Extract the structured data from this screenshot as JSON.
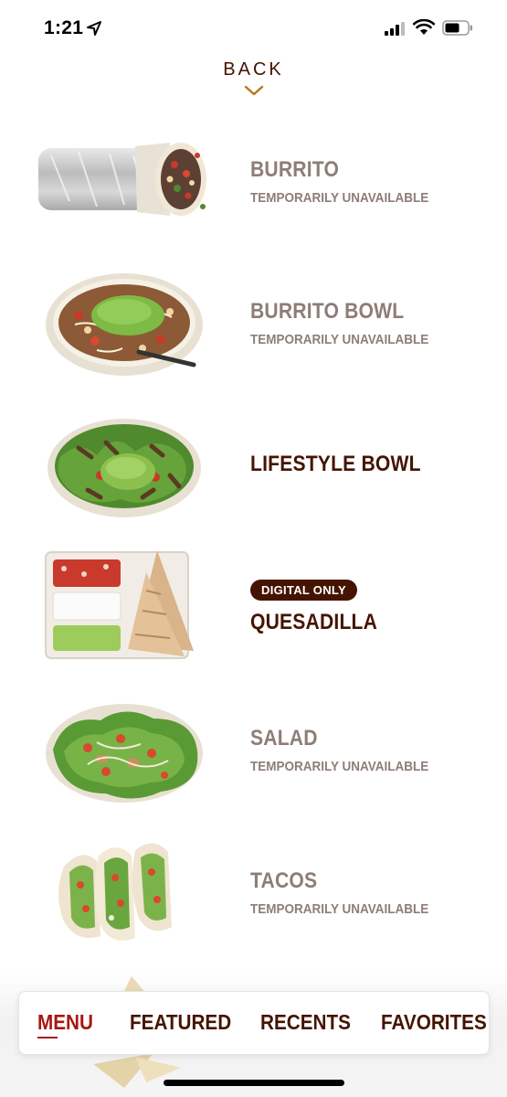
{
  "status_bar": {
    "time": "1:21",
    "icons": [
      "location-arrow-icon",
      "cellular-signal-icon",
      "wifi-icon",
      "battery-icon"
    ]
  },
  "back": {
    "label": "BACK",
    "icon": "chevron-down-icon"
  },
  "menu": {
    "items": [
      {
        "name": "BURRITO",
        "status": "TEMPORARILY UNAVAILABLE",
        "badge": "",
        "image": "burrito-image"
      },
      {
        "name": "BURRITO BOWL",
        "status": "TEMPORARILY UNAVAILABLE",
        "badge": "",
        "image": "burrito-bowl-image"
      },
      {
        "name": "LIFESTYLE BOWL",
        "status": "",
        "badge": "",
        "image": "lifestyle-bowl-image"
      },
      {
        "name": "QUESADILLA",
        "status": "",
        "badge": "DIGITAL ONLY",
        "image": "quesadilla-image"
      },
      {
        "name": "SALAD",
        "status": "TEMPORARILY UNAVAILABLE",
        "badge": "",
        "image": "salad-image"
      },
      {
        "name": "TACOS",
        "status": "TEMPORARILY UNAVAILABLE",
        "badge": "",
        "image": "tacos-image"
      }
    ]
  },
  "bottom_nav": {
    "tabs": [
      {
        "label": "MENU",
        "active": true
      },
      {
        "label": "FEATURED",
        "active": false
      },
      {
        "label": "RECENTS",
        "active": false
      },
      {
        "label": "FAVORITES",
        "active": false
      }
    ]
  },
  "colors": {
    "brand_brown": "#451400",
    "unavailable_text": "#8e7d76",
    "active_tab": "#a81612",
    "background": "#ffffff"
  }
}
